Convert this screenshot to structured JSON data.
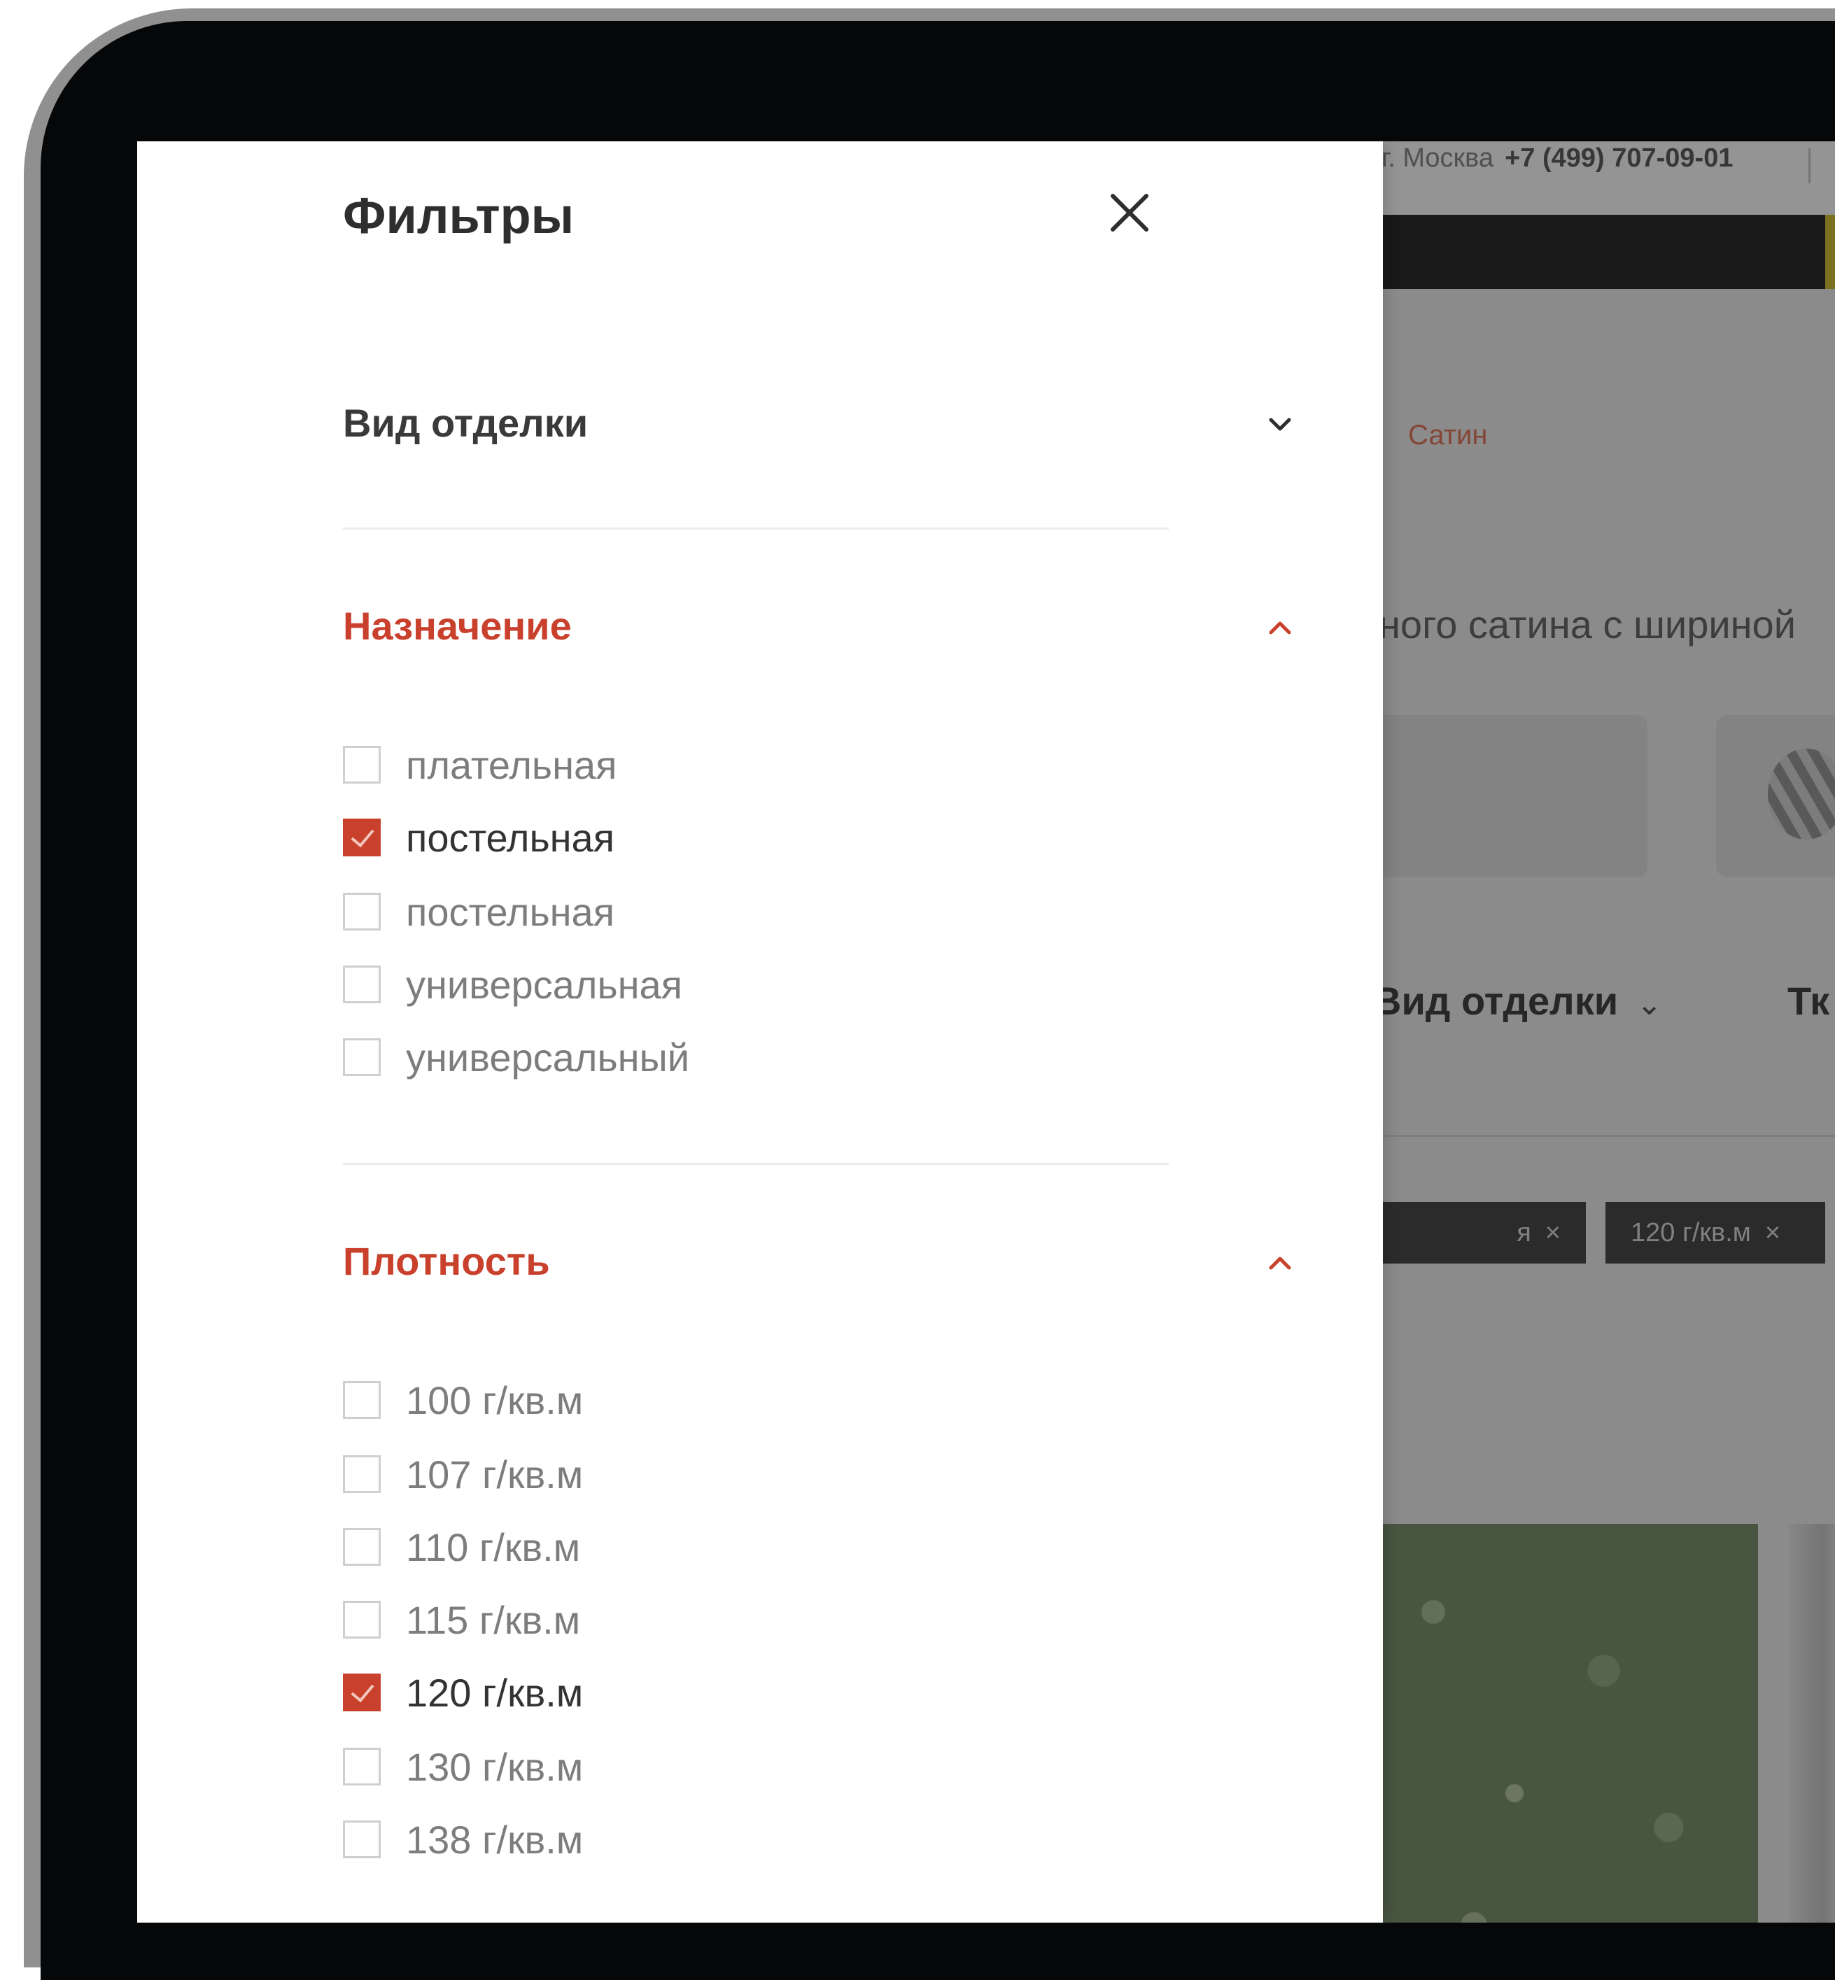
{
  "background_page": {
    "city": "г. Москва",
    "phone": "+7 (499) 707-09-01",
    "breadcrumb_current": "Сатин",
    "description_fragment": "ного сатина с шириной",
    "filter_bar": {
      "item1": "Вид отделки",
      "item2_fragment": "Тк"
    },
    "chips": [
      {
        "label": "я",
        "remove": "×"
      },
      {
        "label": "120 г/кв.м",
        "remove": "×"
      }
    ]
  },
  "filters": {
    "title": "Фильтры",
    "close_icon": "close-icon",
    "sections": [
      {
        "title": "Вид отделки",
        "expanded": false,
        "options": []
      },
      {
        "title": "Назначение",
        "expanded": true,
        "options": [
          {
            "label": "плательная",
            "checked": false
          },
          {
            "label": "постельная",
            "checked": true
          },
          {
            "label": "постельная",
            "checked": false
          },
          {
            "label": "универсальная",
            "checked": false
          },
          {
            "label": "универсальный",
            "checked": false
          }
        ]
      },
      {
        "title": "Плотность",
        "expanded": true,
        "options": [
          {
            "label": "100 г/кв.м",
            "checked": false
          },
          {
            "label": "107 г/кв.м",
            "checked": false
          },
          {
            "label": "110 г/кв.м",
            "checked": false
          },
          {
            "label": "115 г/кв.м",
            "checked": false
          },
          {
            "label": "120 г/кв.м",
            "checked": true
          },
          {
            "label": "130 г/кв.м",
            "checked": false
          },
          {
            "label": "138 г/кв.м",
            "checked": false
          }
        ]
      }
    ]
  },
  "colors": {
    "accent": "#c9412d",
    "text_dark": "#2e2e2e",
    "text_muted": "#7d7d7d"
  }
}
